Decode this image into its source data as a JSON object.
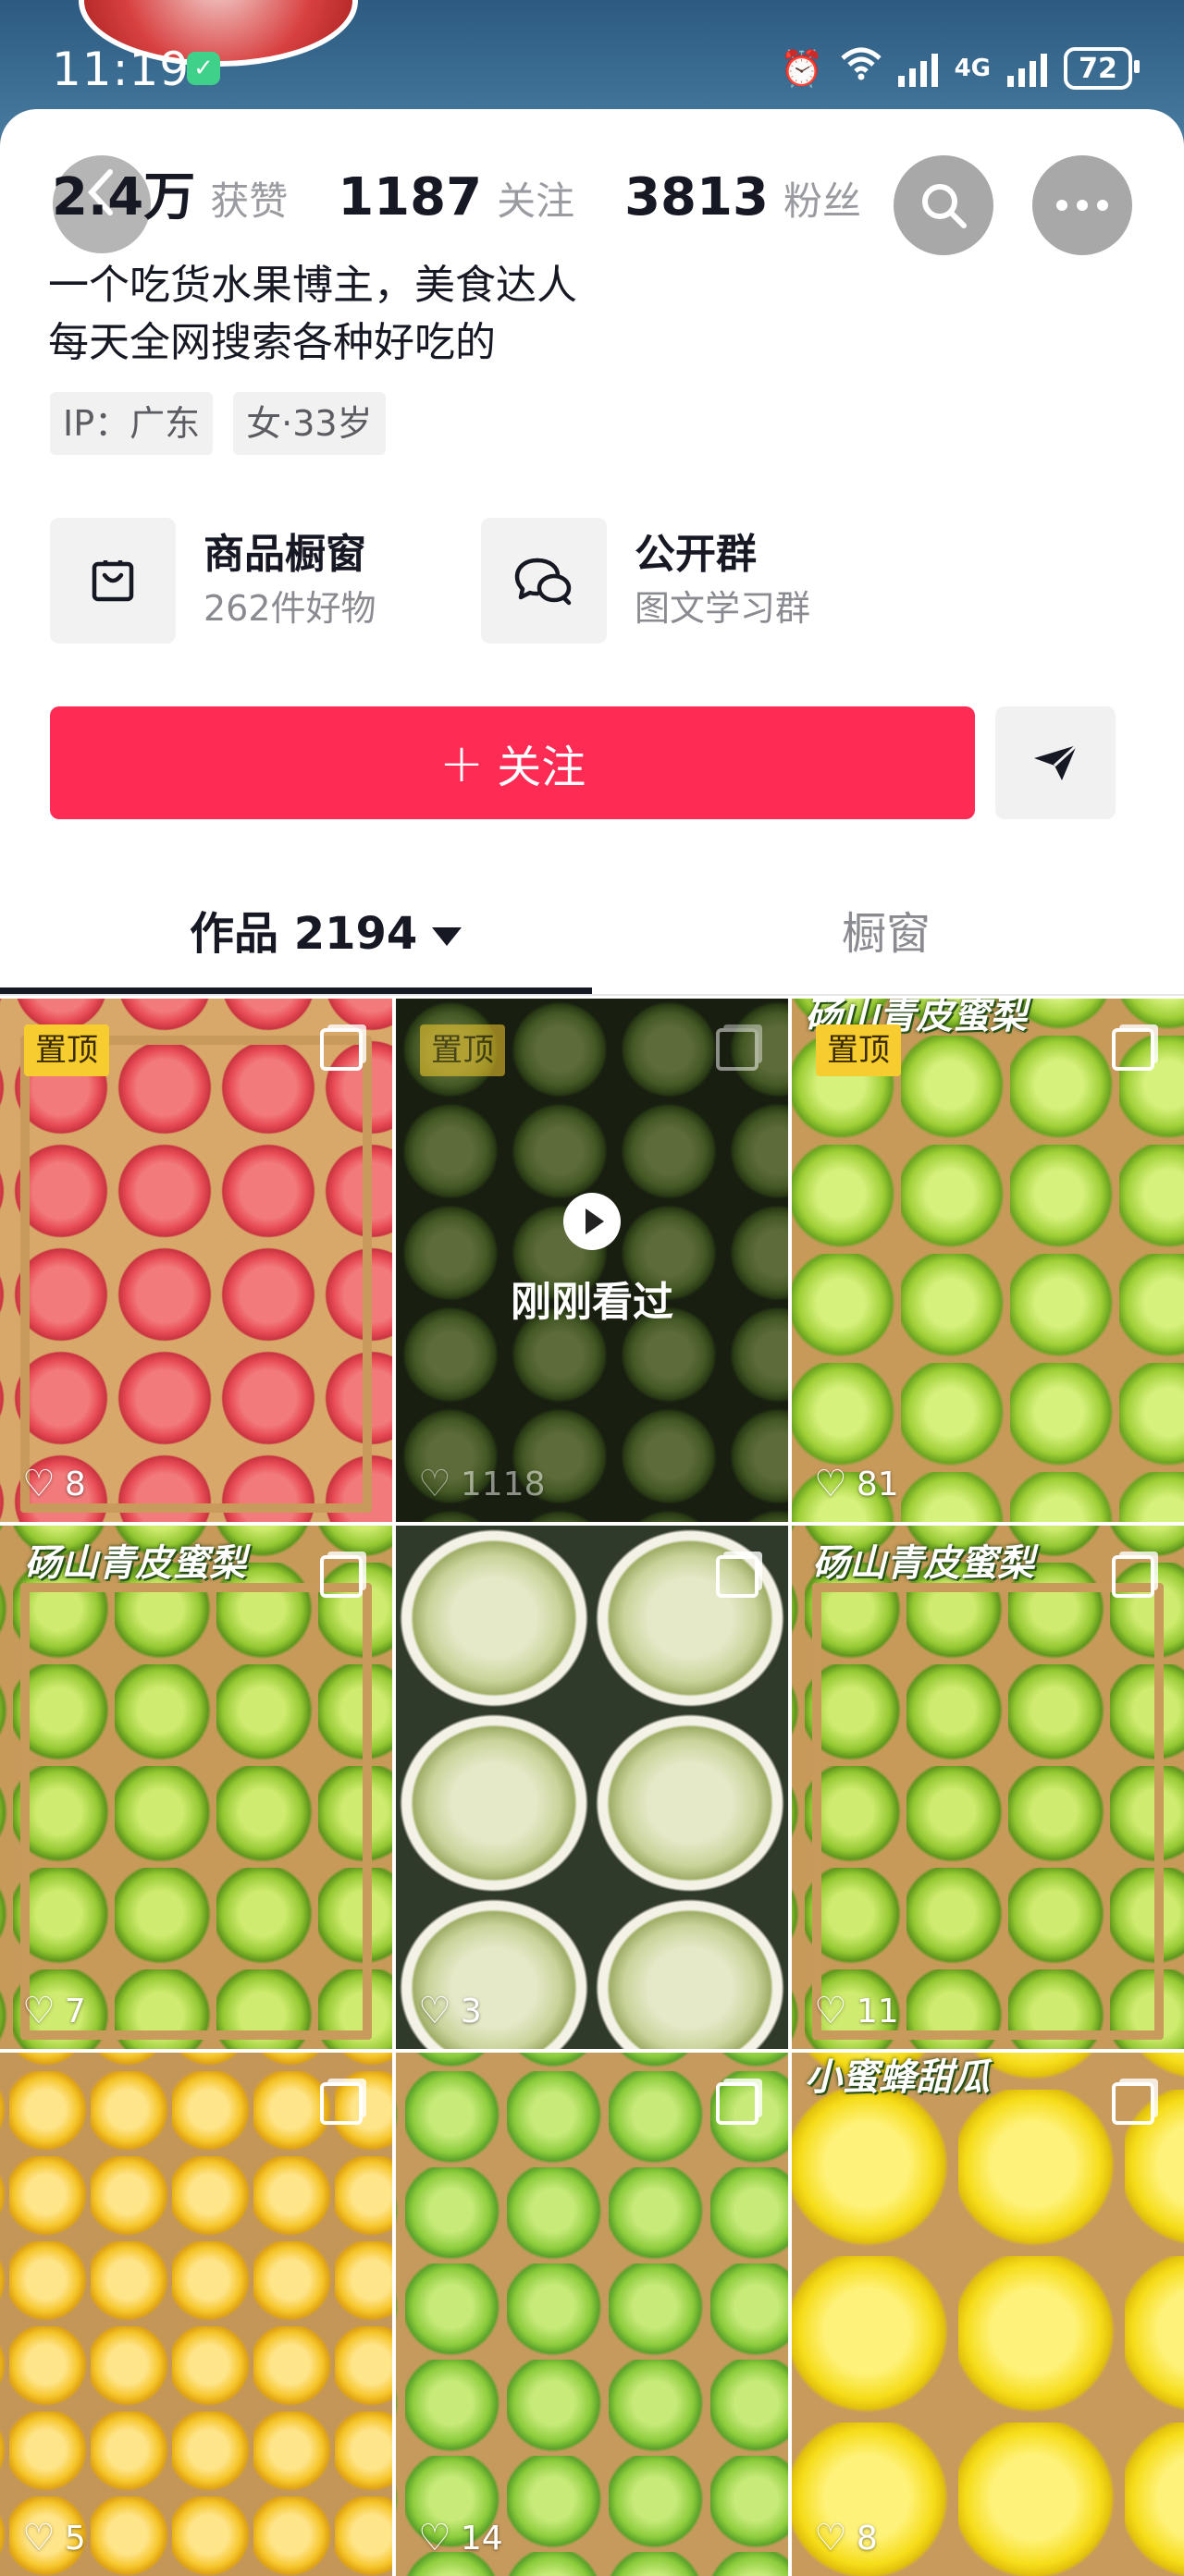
{
  "status_bar": {
    "time": "11:19",
    "network": "4G",
    "battery": "72"
  },
  "profile": {
    "stats": [
      {
        "value": "2.4万",
        "label": "获赞"
      },
      {
        "value": "1187",
        "label": "关注"
      },
      {
        "value": "3813",
        "label": "粉丝"
      }
    ],
    "bio_lines": [
      "一个吃货水果博主，美食达人",
      "每天全网搜索各种好吃的"
    ],
    "tags": [
      "IP：广东",
      "女·33岁"
    ],
    "features": [
      {
        "title": "商品橱窗",
        "subtitle": "262件好物",
        "icon": "bag-icon"
      },
      {
        "title": "公开群",
        "subtitle": "图文学习群",
        "icon": "chat-icon"
      }
    ],
    "follow_label": "关注",
    "follow_plus": "+"
  },
  "tabs": {
    "works_label": "作品 2194",
    "store_label": "橱窗"
  },
  "grid": {
    "pinned_label": "置顶",
    "watched_label": "刚刚看过",
    "heart_glyph": "♡",
    "items": [
      {
        "likes": "8",
        "pinned": true,
        "caption": ""
      },
      {
        "likes": "1118",
        "pinned": true,
        "caption": "",
        "watched": true
      },
      {
        "likes": "81",
        "pinned": true,
        "caption": "砀山青皮蜜梨"
      },
      {
        "likes": "7",
        "pinned": false,
        "caption": "砀山青皮蜜梨"
      },
      {
        "likes": "3",
        "pinned": false,
        "caption": ""
      },
      {
        "likes": "11",
        "pinned": false,
        "caption": "砀山青皮蜜梨"
      },
      {
        "likes": "5",
        "pinned": false,
        "caption": ""
      },
      {
        "likes": "14",
        "pinned": false,
        "caption": ""
      },
      {
        "likes": "8",
        "pinned": false,
        "caption": "小蜜蜂甜瓜"
      }
    ]
  },
  "colors": {
    "accent": "#fe2c55",
    "pin": "#f7cc2e"
  }
}
